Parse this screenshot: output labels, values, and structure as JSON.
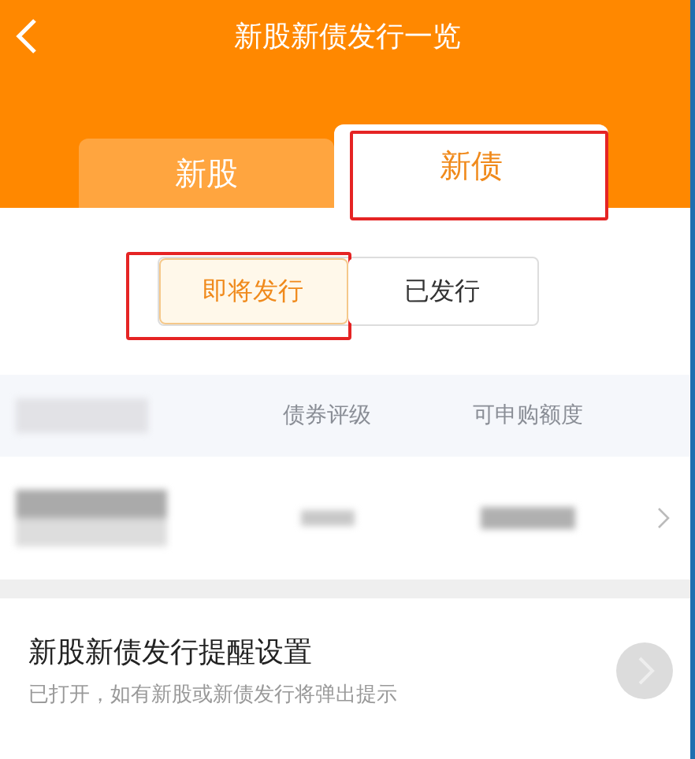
{
  "header": {
    "title": "新股新债发行一览"
  },
  "tabs": [
    {
      "label": "新股",
      "selected": false,
      "highlighted": false
    },
    {
      "label": "新债",
      "selected": true,
      "highlighted": true
    }
  ],
  "segments": [
    {
      "label": "即将发行",
      "selected": true,
      "highlighted": true
    },
    {
      "label": "已发行",
      "selected": false,
      "highlighted": false
    }
  ],
  "table": {
    "columns": [
      {
        "kind": "redacted"
      },
      {
        "kind": "text",
        "label": "债券评级"
      },
      {
        "kind": "text",
        "label": "可申购额度"
      }
    ],
    "rows": [
      {
        "cells": [
          {
            "kind": "redacted"
          },
          {
            "kind": "redacted"
          },
          {
            "kind": "redacted"
          }
        ]
      }
    ]
  },
  "reminder": {
    "title": "新股新债发行提醒设置",
    "subtitle": "已打开，如有新股或新债发行将弹出提示"
  }
}
